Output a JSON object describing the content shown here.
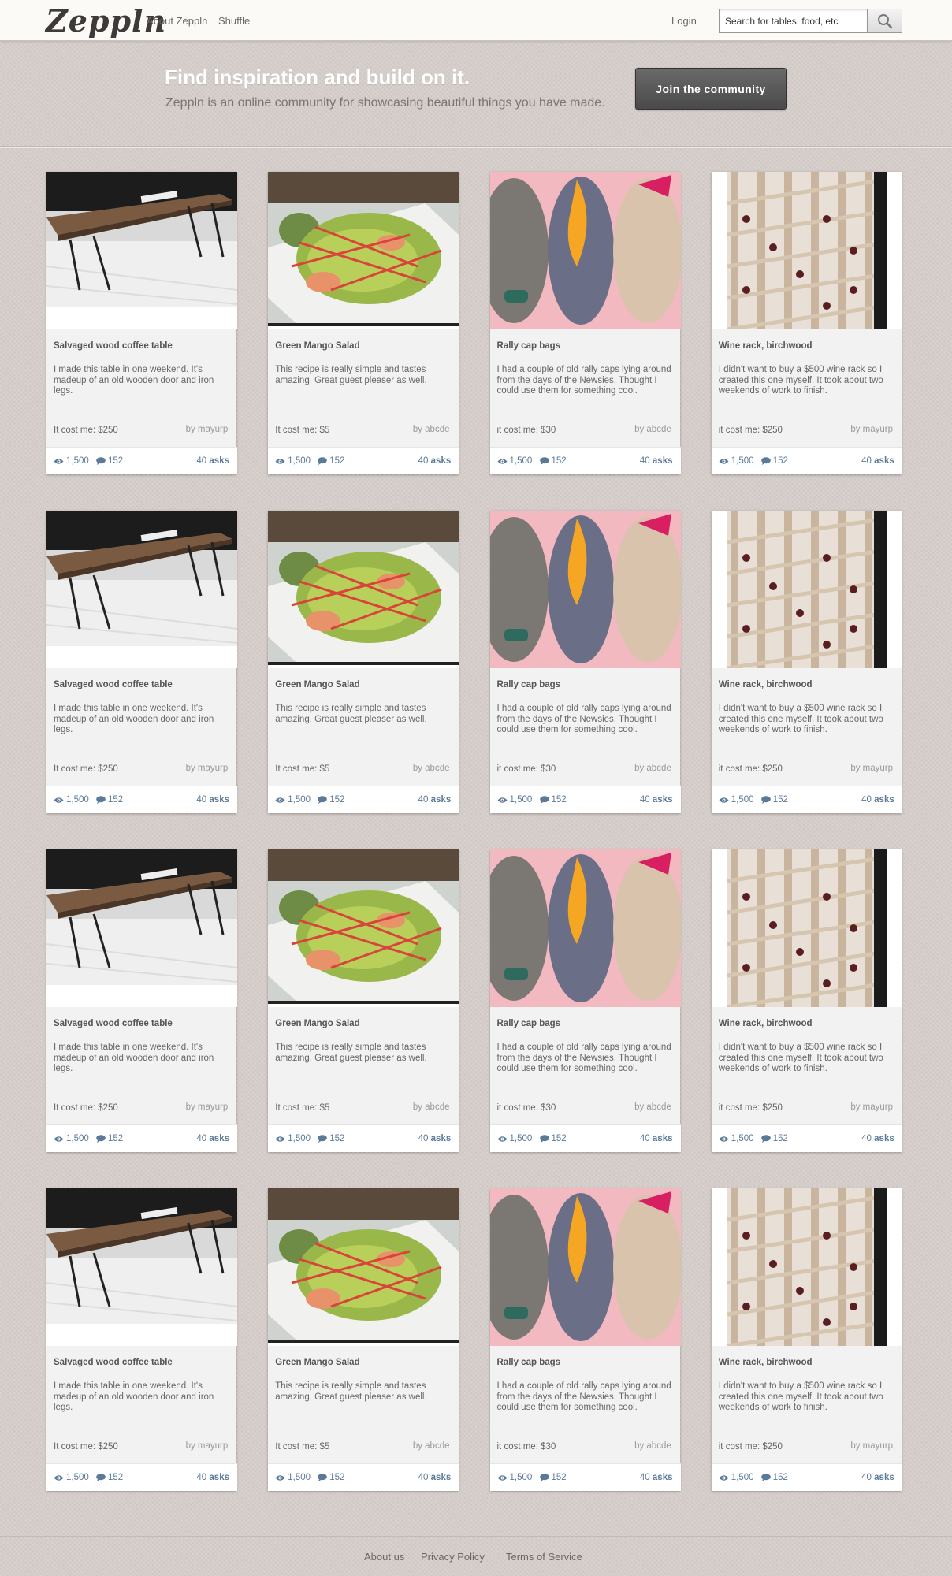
{
  "header": {
    "logo": "Zeppln",
    "nav": {
      "about": "About Zeppln",
      "shuffle": "Shuffle",
      "login": "Login"
    },
    "search": {
      "placeholder": "Search for tables, food, etc"
    }
  },
  "hero": {
    "title": "Find inspiration and build on it.",
    "subtitle": "Zeppln is an online community for showcasing beautiful things you have made.",
    "join_label": "Join the community"
  },
  "cards": [
    {
      "image": "coffee-table",
      "title": "Salvaged wood coffee table",
      "description": "I made this table in one weekend. It's madeup of an old wooden door and iron legs.",
      "cost": "It cost me: $250",
      "author": "by  mayurp",
      "views": "1,500",
      "comments": "152",
      "asks_count": "40",
      "asks_label": "asks"
    },
    {
      "image": "mango-salad",
      "title": "Green Mango Salad",
      "description": "This recipe is really simple and tastes amazing. Great guest pleaser as well.",
      "cost": "It cost me: $5",
      "author": "by abcde",
      "views": "1,500",
      "comments": "152",
      "asks_count": "40",
      "asks_label": "asks"
    },
    {
      "image": "rally-cap-bags",
      "title": "Rally cap bags",
      "description": "I had a couple of old rally caps lying around from the days of the Newsies. Thought I could use them for something cool.",
      "cost": "it cost me: $30",
      "author": "by abcde",
      "views": "1,500",
      "comments": "152",
      "asks_count": "40",
      "asks_label": "asks"
    },
    {
      "image": "wine-rack",
      "title": "Wine rack, birchwood",
      "description": "I didn't want to buy a $500 wine rack so I created this one myself.  It took about two weekends of work to finish.",
      "cost": "it cost me: $250",
      "author": "by  mayurp",
      "views": "1,500",
      "comments": "152",
      "asks_count": "40",
      "asks_label": "asks"
    }
  ],
  "footer": {
    "about": "About us",
    "privacy": "Privacy Policy",
    "terms": "Terms of Service"
  }
}
